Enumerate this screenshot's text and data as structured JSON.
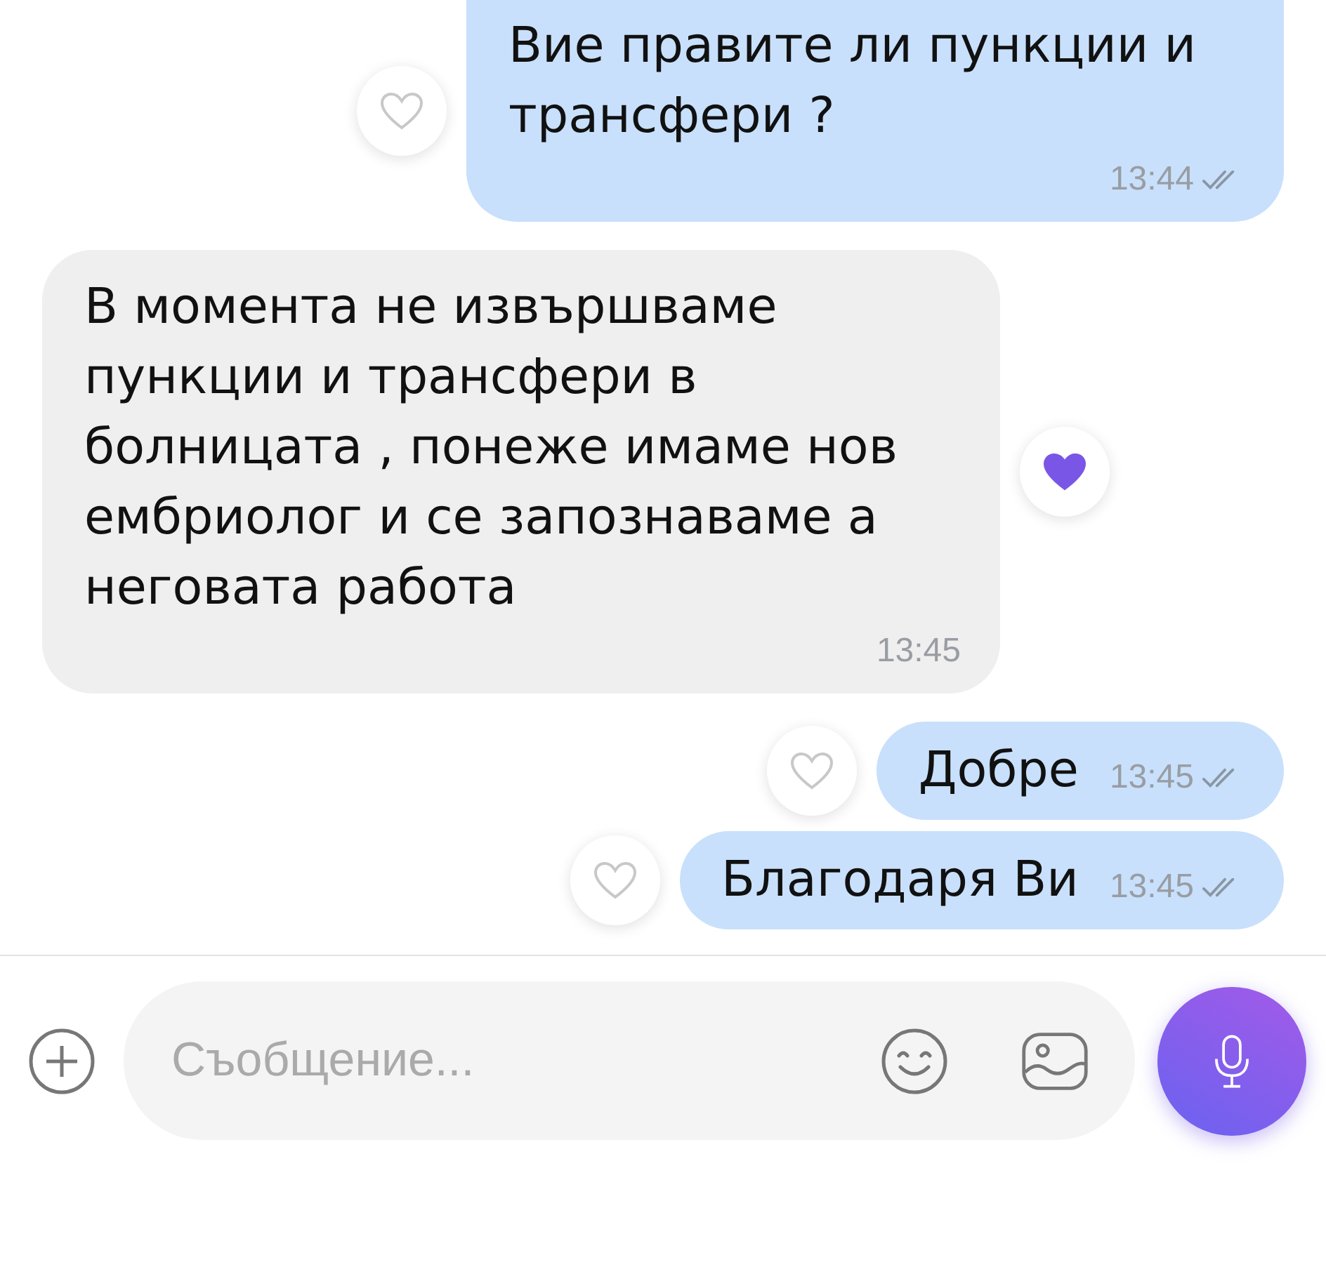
{
  "messages": [
    {
      "kind": "sent",
      "text": "Вие правите ли пункции и трансфери ?",
      "time": "13:44",
      "liked": false,
      "read": true
    },
    {
      "kind": "received",
      "text": "В момента не извършваме пункции и трансфери в болницата , понеже имаме нов ембриолог и се запознаваме а неговата работа",
      "time": "13:45",
      "liked": true
    },
    {
      "kind": "sent",
      "text": "Добре",
      "time": "13:45",
      "liked": false,
      "read": true
    },
    {
      "kind": "sent",
      "text": "Благодаря Ви",
      "time": "13:45",
      "liked": false,
      "read": true
    }
  ],
  "composer": {
    "placeholder": "Съобщение..."
  }
}
